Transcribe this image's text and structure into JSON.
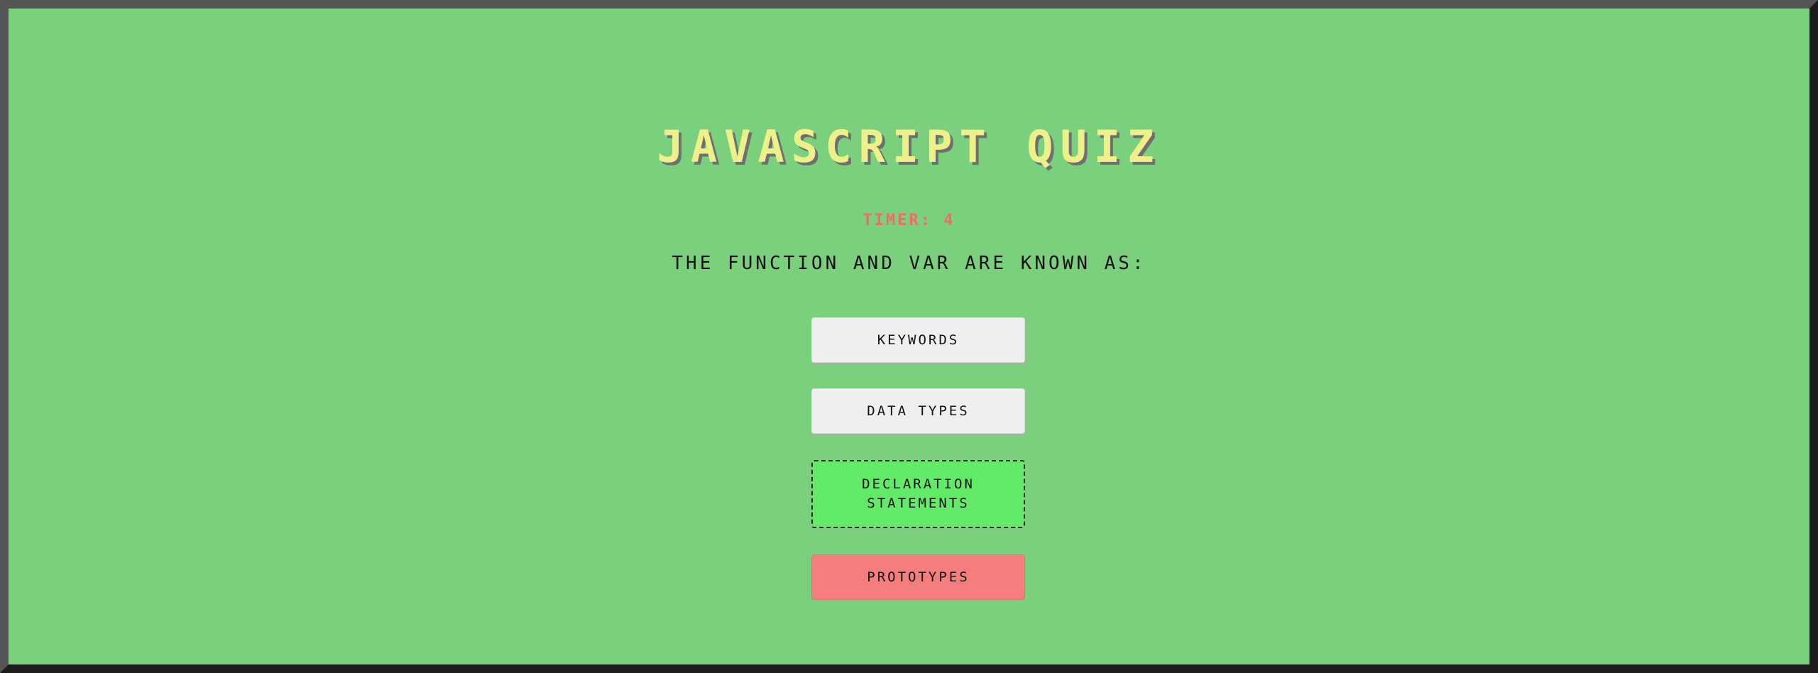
{
  "app": {
    "title": "JAVASCRIPT QUIZ"
  },
  "timer": {
    "text": "TIMER: 4"
  },
  "question": {
    "text": "THE FUNCTION AND VAR ARE KNOWN AS:"
  },
  "answers": [
    {
      "label": "KEYWORDS",
      "state": "default"
    },
    {
      "label": "DATA TYPES",
      "state": "default"
    },
    {
      "label": "DECLARATION STATEMENTS",
      "state": "selected"
    },
    {
      "label": "PROTOTYPES",
      "state": "wrong"
    }
  ],
  "colors": {
    "background": "#7bd07e",
    "title": "#eef08a",
    "timer": "#f06a6a",
    "answer_default": "#efefef",
    "answer_selected": "#62ea68",
    "answer_wrong": "#f47d7d"
  }
}
